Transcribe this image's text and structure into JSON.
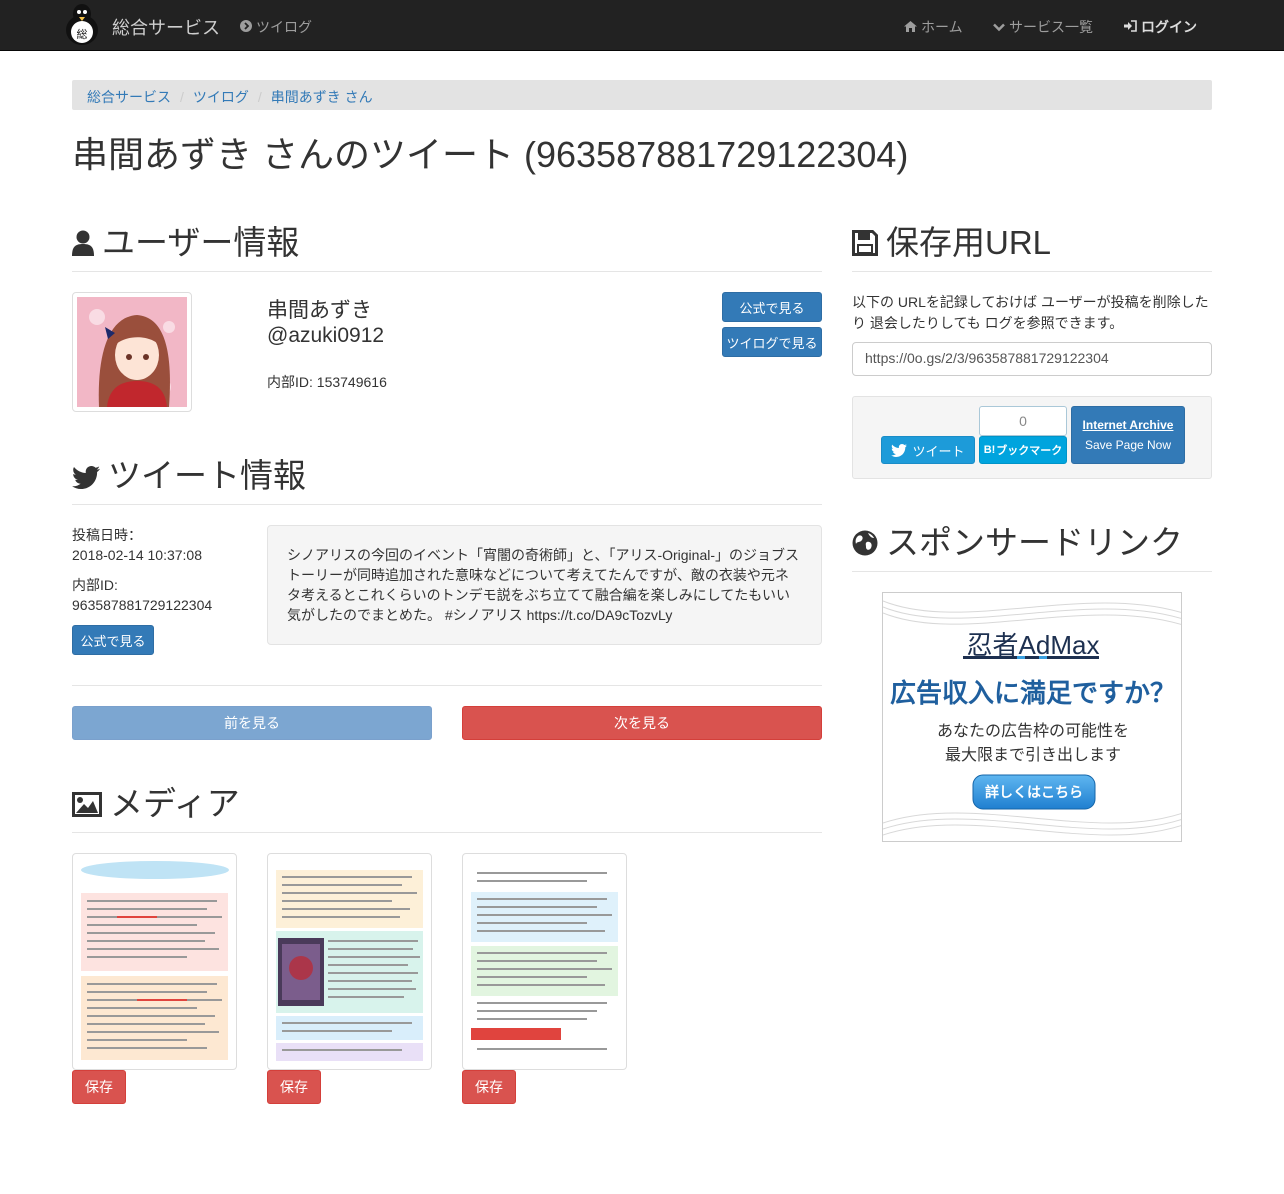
{
  "navbar": {
    "brand": "総合サービス",
    "tsuilog": "ツイログ",
    "home": "ホーム",
    "services": "サービス一覧",
    "login": "ログイン"
  },
  "breadcrumb": [
    "総合サービス",
    "ツイログ",
    "串間あずき さん"
  ],
  "page_title": "串間あずき さんのツイート (963587881729122304)",
  "user_section": {
    "heading": "ユーザー情報",
    "name": "串間あずき",
    "handle": "@azuki0912",
    "internal_id": "内部ID: 153749616",
    "btn_official": "公式で見る",
    "btn_tsuilog": "ツイログで見る"
  },
  "tweet_section": {
    "heading": "ツイート情報",
    "posted_label": "投稿日時：",
    "posted_value": "2018-02-14 10:37:08",
    "id_label": "内部ID:",
    "id_value": "963587881729122304",
    "btn_official": "公式で見る",
    "text": "シノアリスの今回のイベント「宵闇の奇術師」と、「アリス-Original-」のジョブストーリーが同時追加された意味などについて考えてたんですが、敵の衣装や元ネタ考えるとこれくらいのトンデモ説をぶち立てて融合編を楽しみにしてたもいい気がしたのでまとめた。 #シノアリス https://t.co/DA9cTozvLy"
  },
  "pager": {
    "prev": "前を見る",
    "next": "次を見る"
  },
  "media_section": {
    "heading": "メディア",
    "save": "保存"
  },
  "save_section": {
    "heading": "保存用URL",
    "description": "以下の URLを記録しておけば ユーザーが投稿を削除したり 退会したりしても ログを参照できます。",
    "url": "https://0o.gs/2/3/963587881729122304",
    "tweet_btn": "ツイート",
    "hatena_count": "0",
    "hatena_label": "ブックマーク",
    "archive_title": "Internet Archive",
    "archive_sub": "Save Page Now"
  },
  "sponsor_section": {
    "heading": "スポンサードリンク",
    "ad_brand": "忍者AdMax",
    "ad_headline": "広告収入に満足ですか？",
    "ad_line1": "あなたの広告枠の可能性を",
    "ad_line2": "最大限まで引き出します",
    "ad_cta": "詳しくはこちら"
  },
  "colors": {
    "navbar": "#222222",
    "primary": "#337ab7",
    "danger": "#d9534f",
    "twitter": "#1da1f2",
    "hatena": "#00a4de"
  }
}
